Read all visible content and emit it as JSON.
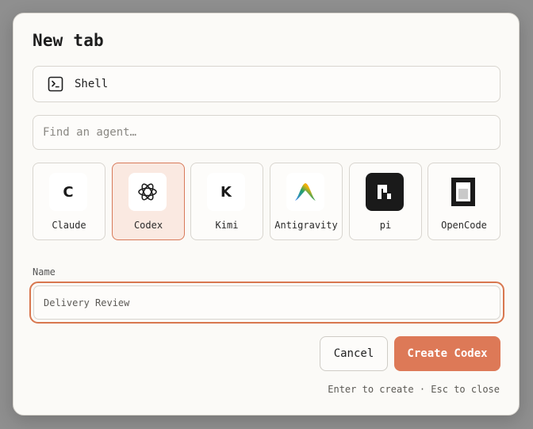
{
  "dialog": {
    "title": "New tab",
    "shell": {
      "label": "Shell",
      "icon": "terminal-icon"
    },
    "search": {
      "placeholder": "Find an agent…",
      "value": ""
    },
    "agents": [
      {
        "name": "Claude",
        "letter": "C",
        "icon": "claude-logo-icon",
        "selected": false
      },
      {
        "name": "Codex",
        "icon": "codex-logo-icon",
        "selected": true
      },
      {
        "name": "Kimi",
        "letter": "K",
        "icon": "kimi-logo-icon",
        "selected": false
      },
      {
        "name": "Antigravity",
        "icon": "antigravity-logo-icon",
        "selected": false
      },
      {
        "name": "pi",
        "icon": "pi-logo-icon",
        "selected": false
      },
      {
        "name": "OpenCode",
        "icon": "opencode-logo-icon",
        "selected": false
      }
    ],
    "name_field": {
      "label": "Name",
      "placeholder": "Delivery Review",
      "value": ""
    },
    "buttons": {
      "cancel": "Cancel",
      "create": "Create Codex"
    },
    "hint": "Enter to create · Esc to close"
  },
  "colors": {
    "accent": "#dd7957",
    "selected_bg": "#fae9e1",
    "dialog_bg": "#fbfaf7",
    "backdrop": "#8f8f8f"
  }
}
